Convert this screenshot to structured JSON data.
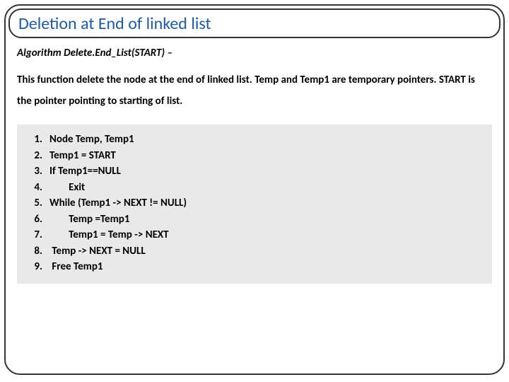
{
  "title": "Deletion at End of linked list",
  "algorithm": {
    "heading": "Algorithm Delete.End_List(START) –",
    "description": "This function delete the node at the end of linked list. Temp and Temp1 are temporary pointers. START is the pointer pointing to starting of list.",
    "steps": [
      {
        "n": "1.",
        "t": "Node Temp, Temp1"
      },
      {
        "n": "2.",
        "t": "Temp1 = START"
      },
      {
        "n": "3.",
        "t": "If Temp1==NULL"
      },
      {
        "n": "4.",
        "t": "        Exit"
      },
      {
        "n": "5.",
        "t": "While (Temp1 -> NEXT != NULL)"
      },
      {
        "n": "6.",
        "t": "        Temp =Temp1"
      },
      {
        "n": "7.",
        "t": "        Temp1 = Temp -> NEXT"
      },
      {
        "n": "8.",
        "t": " Temp -> NEXT = NULL"
      },
      {
        "n": "9.",
        "t": " Free Temp1"
      }
    ]
  }
}
